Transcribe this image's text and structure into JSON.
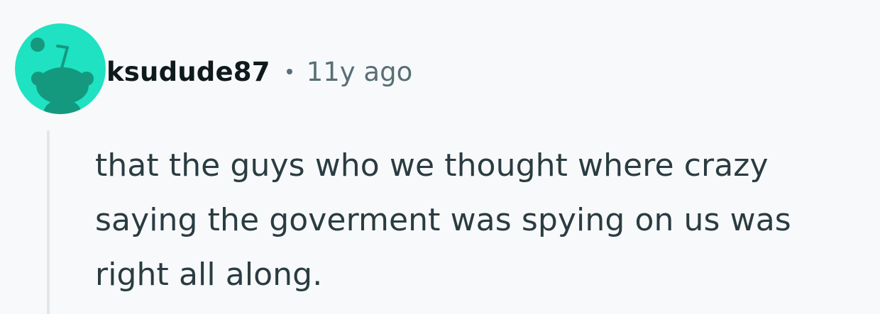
{
  "comment": {
    "author": "ksudude87",
    "timestamp": "11y ago",
    "body": "that the guys who we thought where crazy saying the goverment was spying on us was right all along.",
    "avatar_icon": "snoo-avatar-icon"
  },
  "colors": {
    "background": "#f8f9fa",
    "avatar_bg": "#1ee2c2",
    "avatar_figure": "#14997f",
    "author_text": "#0f1a1c",
    "meta_text": "#576f76",
    "body_text": "#2a3c42",
    "thread_line": "#e2e7e9"
  }
}
